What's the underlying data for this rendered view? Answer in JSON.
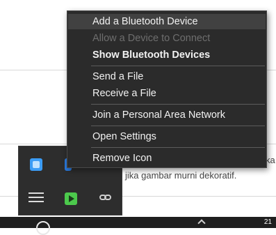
{
  "background": {
    "partial_text_1": "ka",
    "partial_text_2": "jika gambar murni dekoratif."
  },
  "taskbar": {
    "clock": "21"
  },
  "tray": {
    "icons": [
      "app-blue-icon",
      "bluetooth-icon",
      "playlist-icon",
      "media-green-icon",
      "link-icon"
    ]
  },
  "context_menu": {
    "items": [
      {
        "label": "Add a Bluetooth Device",
        "state": "hover"
      },
      {
        "label": "Allow a Device to Connect",
        "state": "disabled"
      },
      {
        "label": "Show Bluetooth Devices",
        "state": "bold"
      },
      {
        "label": "Send a File",
        "state": "normal"
      },
      {
        "label": "Receive a File",
        "state": "normal"
      },
      {
        "label": "Join a Personal Area Network",
        "state": "normal"
      },
      {
        "label": "Open Settings",
        "state": "normal"
      },
      {
        "label": "Remove Icon",
        "state": "normal"
      }
    ]
  }
}
